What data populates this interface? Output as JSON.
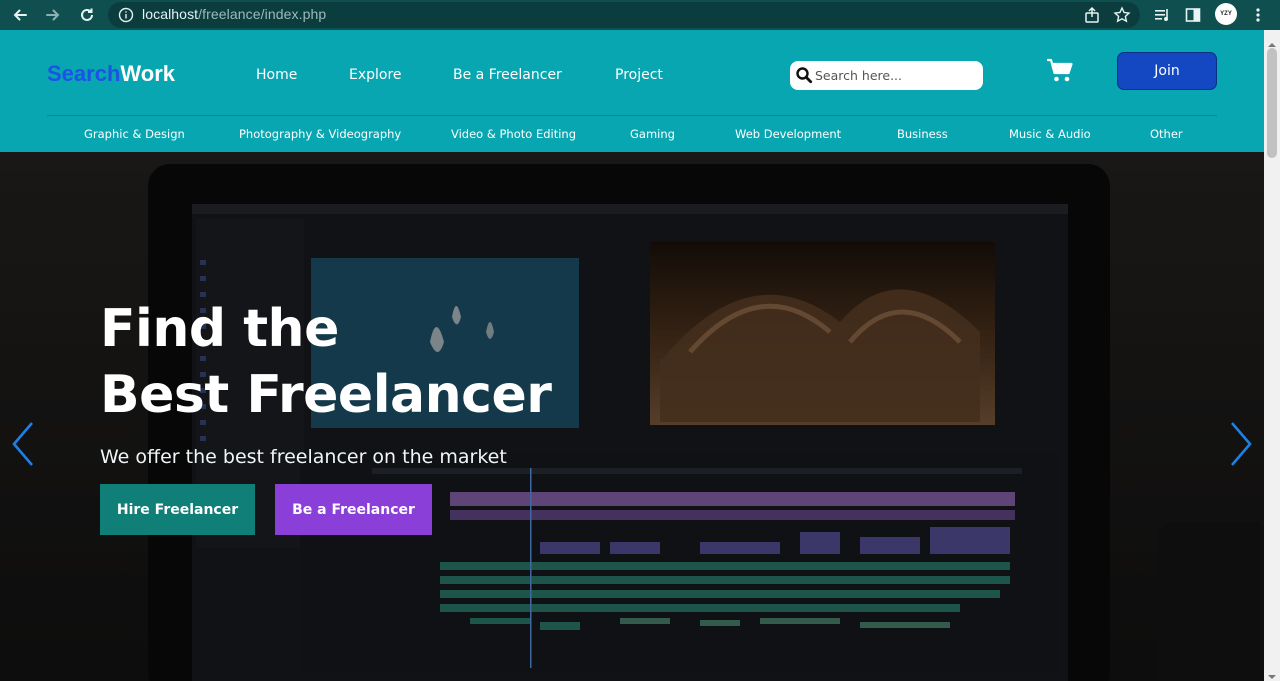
{
  "browser": {
    "url_host": "localhost",
    "url_path": "/freelance/index.php",
    "profile_initials": "YZY",
    "icons": [
      "back-icon",
      "forward-icon",
      "reload-icon",
      "info-icon",
      "share-icon",
      "star-icon",
      "media-icon",
      "sidepanel-icon",
      "menu-dots-icon"
    ]
  },
  "header": {
    "logo_part1": "Search",
    "logo_part2": "Work",
    "nav": [
      "Home",
      "Explore",
      "Be a Freelancer",
      "Project"
    ],
    "search_placeholder": "Search here...",
    "join_label": "Join",
    "categories": [
      "Graphic & Design",
      "Photography & Videography",
      "Video & Photo Editing",
      "Gaming",
      "Web Development",
      "Business",
      "Music & Audio",
      "Other"
    ],
    "colors": {
      "header_bg": "#08a6b1",
      "logo_accent": "#1d52e6",
      "join_bg": "#1447c2"
    }
  },
  "hero": {
    "title_line1": "Find the",
    "title_line2": "Best Freelancer",
    "subtitle": "We offer the best freelancer on the market",
    "btn_hire": "Hire Freelancer",
    "btn_be": "Be a Freelancer",
    "colors": {
      "hire_bg": "#0f7f77",
      "be_bg": "#8a3fd8",
      "arrow": "#1e7fe6"
    }
  }
}
